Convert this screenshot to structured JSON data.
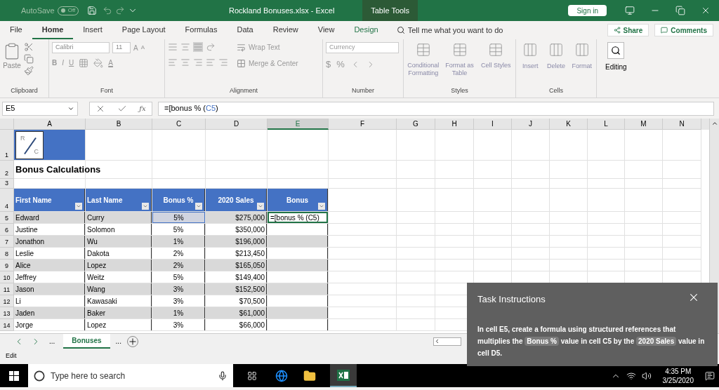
{
  "title_bar": {
    "autosave_label": "AutoSave",
    "autosave": {
      "on": false,
      "label": "Off"
    },
    "title": "Rockland Bonuses.xlsx - Excel",
    "context_tab": "Table Tools",
    "sign_in": "Sign in"
  },
  "menu_tabs": [
    {
      "label": "File",
      "selected": false,
      "kind": "normal"
    },
    {
      "label": "Home",
      "selected": true,
      "kind": "normal"
    },
    {
      "label": "Insert",
      "selected": false,
      "kind": "normal"
    },
    {
      "label": "Page Layout",
      "selected": false,
      "kind": "normal"
    },
    {
      "label": "Formulas",
      "selected": false,
      "kind": "normal"
    },
    {
      "label": "Data",
      "selected": false,
      "kind": "normal"
    },
    {
      "label": "Review",
      "selected": false,
      "kind": "normal"
    },
    {
      "label": "View",
      "selected": false,
      "kind": "normal"
    },
    {
      "label": "Design",
      "selected": false,
      "kind": "contextual"
    }
  ],
  "tell_me": {
    "placeholder": "Tell me what you want to do"
  },
  "share": "Share",
  "comments": "Comments",
  "ribbon": {
    "clipboard": {
      "paste": "Paste",
      "label": "Clipboard"
    },
    "font": {
      "name": "Calibri",
      "size": "11",
      "grow": "A",
      "shrink": "A",
      "bold": "B",
      "italic": "I",
      "underline": "U",
      "font_color": "A",
      "label": "Font"
    },
    "alignment": {
      "wrap": "Wrap Text",
      "merge": "Merge & Center",
      "label": "Alignment"
    },
    "number": {
      "format": "Currency",
      "currency": "$",
      "percent": "%",
      "label": "Number"
    },
    "styles": {
      "buttons": [
        "Conditional Formatting",
        "Format as Table",
        "Cell Styles"
      ],
      "label": "Styles"
    },
    "cells": {
      "buttons": [
        "Insert",
        "Delete",
        "Format"
      ],
      "label": "Cells"
    },
    "editing": "Editing"
  },
  "formula_bar": {
    "name_box": "E5",
    "fx": "ƒx",
    "formula_start": "=[bonus % (",
    "formula_ref": "C5",
    "formula_end": ")"
  },
  "columns": [
    {
      "label": "A",
      "selected": false
    },
    {
      "label": "B",
      "selected": false
    },
    {
      "label": "C",
      "selected": false
    },
    {
      "label": "D",
      "selected": false
    },
    {
      "label": "E",
      "selected": true
    },
    {
      "label": "F",
      "selected": false
    },
    {
      "label": "G",
      "selected": false
    },
    {
      "label": "H",
      "selected": false
    },
    {
      "label": "I",
      "selected": false
    },
    {
      "label": "J",
      "selected": false
    },
    {
      "label": "K",
      "selected": false
    },
    {
      "label": "L",
      "selected": false
    },
    {
      "label": "M",
      "selected": false
    },
    {
      "label": "N",
      "selected": false
    }
  ],
  "row_numbers": [
    "1",
    "2",
    "3",
    "4",
    "5",
    "6",
    "7",
    "8",
    "9",
    "10",
    "11",
    "12",
    "13",
    "14"
  ],
  "logo": {
    "top": "R",
    "bottom": "C"
  },
  "sheet_title": "Bonus Calculations",
  "table": {
    "headers": [
      "First Name",
      "Last Name",
      "Bonus %",
      "2020 Sales",
      "Bonus"
    ],
    "rows": [
      {
        "cells": [
          "Edward",
          "Curry",
          "5%",
          "$275,000",
          "=[bonus % (C5)"
        ],
        "selected": true
      },
      {
        "cells": [
          "Justine",
          "Solomon",
          "5%",
          "$350,000",
          ""
        ],
        "selected": false
      },
      {
        "cells": [
          "Jonathon",
          "Wu",
          "1%",
          "$196,000",
          ""
        ],
        "selected": false
      },
      {
        "cells": [
          "Leslie",
          "Dakota",
          "2%",
          "$213,450",
          ""
        ],
        "selected": false
      },
      {
        "cells": [
          "Alice",
          "Lopez",
          "2%",
          "$165,050",
          ""
        ],
        "selected": false
      },
      {
        "cells": [
          "Jeffrey",
          "Weitz",
          "5%",
          "$149,400",
          ""
        ],
        "selected": false
      },
      {
        "cells": [
          "Jason",
          "Wang",
          "3%",
          "$152,500",
          ""
        ],
        "selected": false
      },
      {
        "cells": [
          "Li",
          "Kawasaki",
          "3%",
          "$70,500",
          ""
        ],
        "selected": false
      },
      {
        "cells": [
          "Jaden",
          "Baker",
          "1%",
          "$61,000",
          ""
        ],
        "selected": false
      },
      {
        "cells": [
          "Jorge",
          "Lopez",
          "3%",
          "$66,000",
          ""
        ],
        "selected": false
      }
    ]
  },
  "sheet_tabs": {
    "more_left": "...",
    "tabs": [
      {
        "label": "Bonuses",
        "selected": true
      }
    ],
    "more_right": "..."
  },
  "status": "Edit",
  "task_panel": {
    "title": "Task Instructions",
    "segments": [
      {
        "kind": "plain",
        "text": "In cell E5, create a formula using structured references that multiplies the "
      },
      {
        "kind": "chip",
        "text": "Bonus %"
      },
      {
        "kind": "plain",
        "text": " value in cell C5 by the "
      },
      {
        "kind": "chip",
        "text": "2020 Sales"
      },
      {
        "kind": "plain",
        "text": " value in cell D5."
      }
    ]
  },
  "taskbar": {
    "search": {
      "placeholder": "Type here to search"
    },
    "time": "4:35 PM",
    "date": "3/25/2020"
  }
}
